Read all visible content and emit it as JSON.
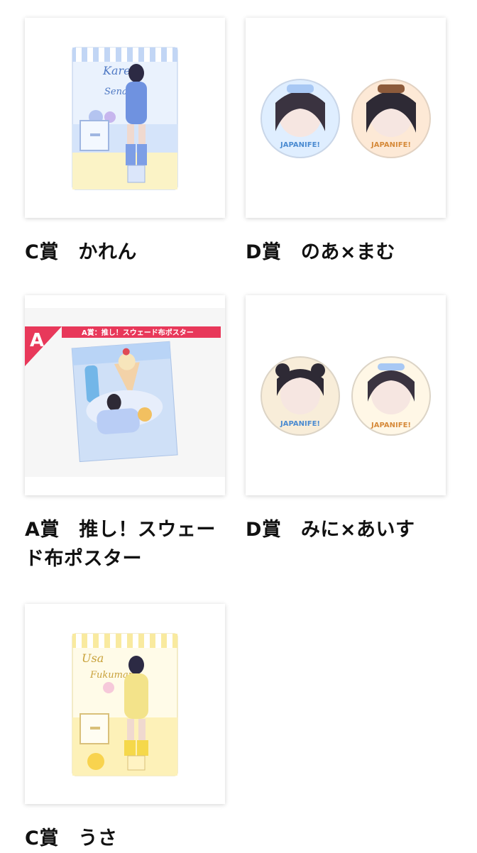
{
  "products": [
    {
      "label": "C賞　かれん",
      "image_text": [
        "Karen",
        "Senata"
      ]
    },
    {
      "label": "D賞　のあ×まむ",
      "image_text": [
        "JAPANIFE!",
        "JAPANIFE!"
      ]
    },
    {
      "label": "A賞　推し！スウェード布ポスター",
      "image_text": [
        "A",
        "A賞：推し！スウェード布ポスター"
      ]
    },
    {
      "label": "D賞　みに×あいす",
      "image_text": [
        "JAPANIFE!",
        "JAPANIFE!"
      ]
    },
    {
      "label": "C賞　うさ",
      "image_text": [
        "Usa",
        "Fukumaru"
      ]
    }
  ],
  "colors": {
    "card_shadow": "#d0d0d0",
    "poster_ribbon": "#e8385a",
    "blue_theme": "#a9c7f0",
    "yellow_theme": "#f6e58e"
  }
}
